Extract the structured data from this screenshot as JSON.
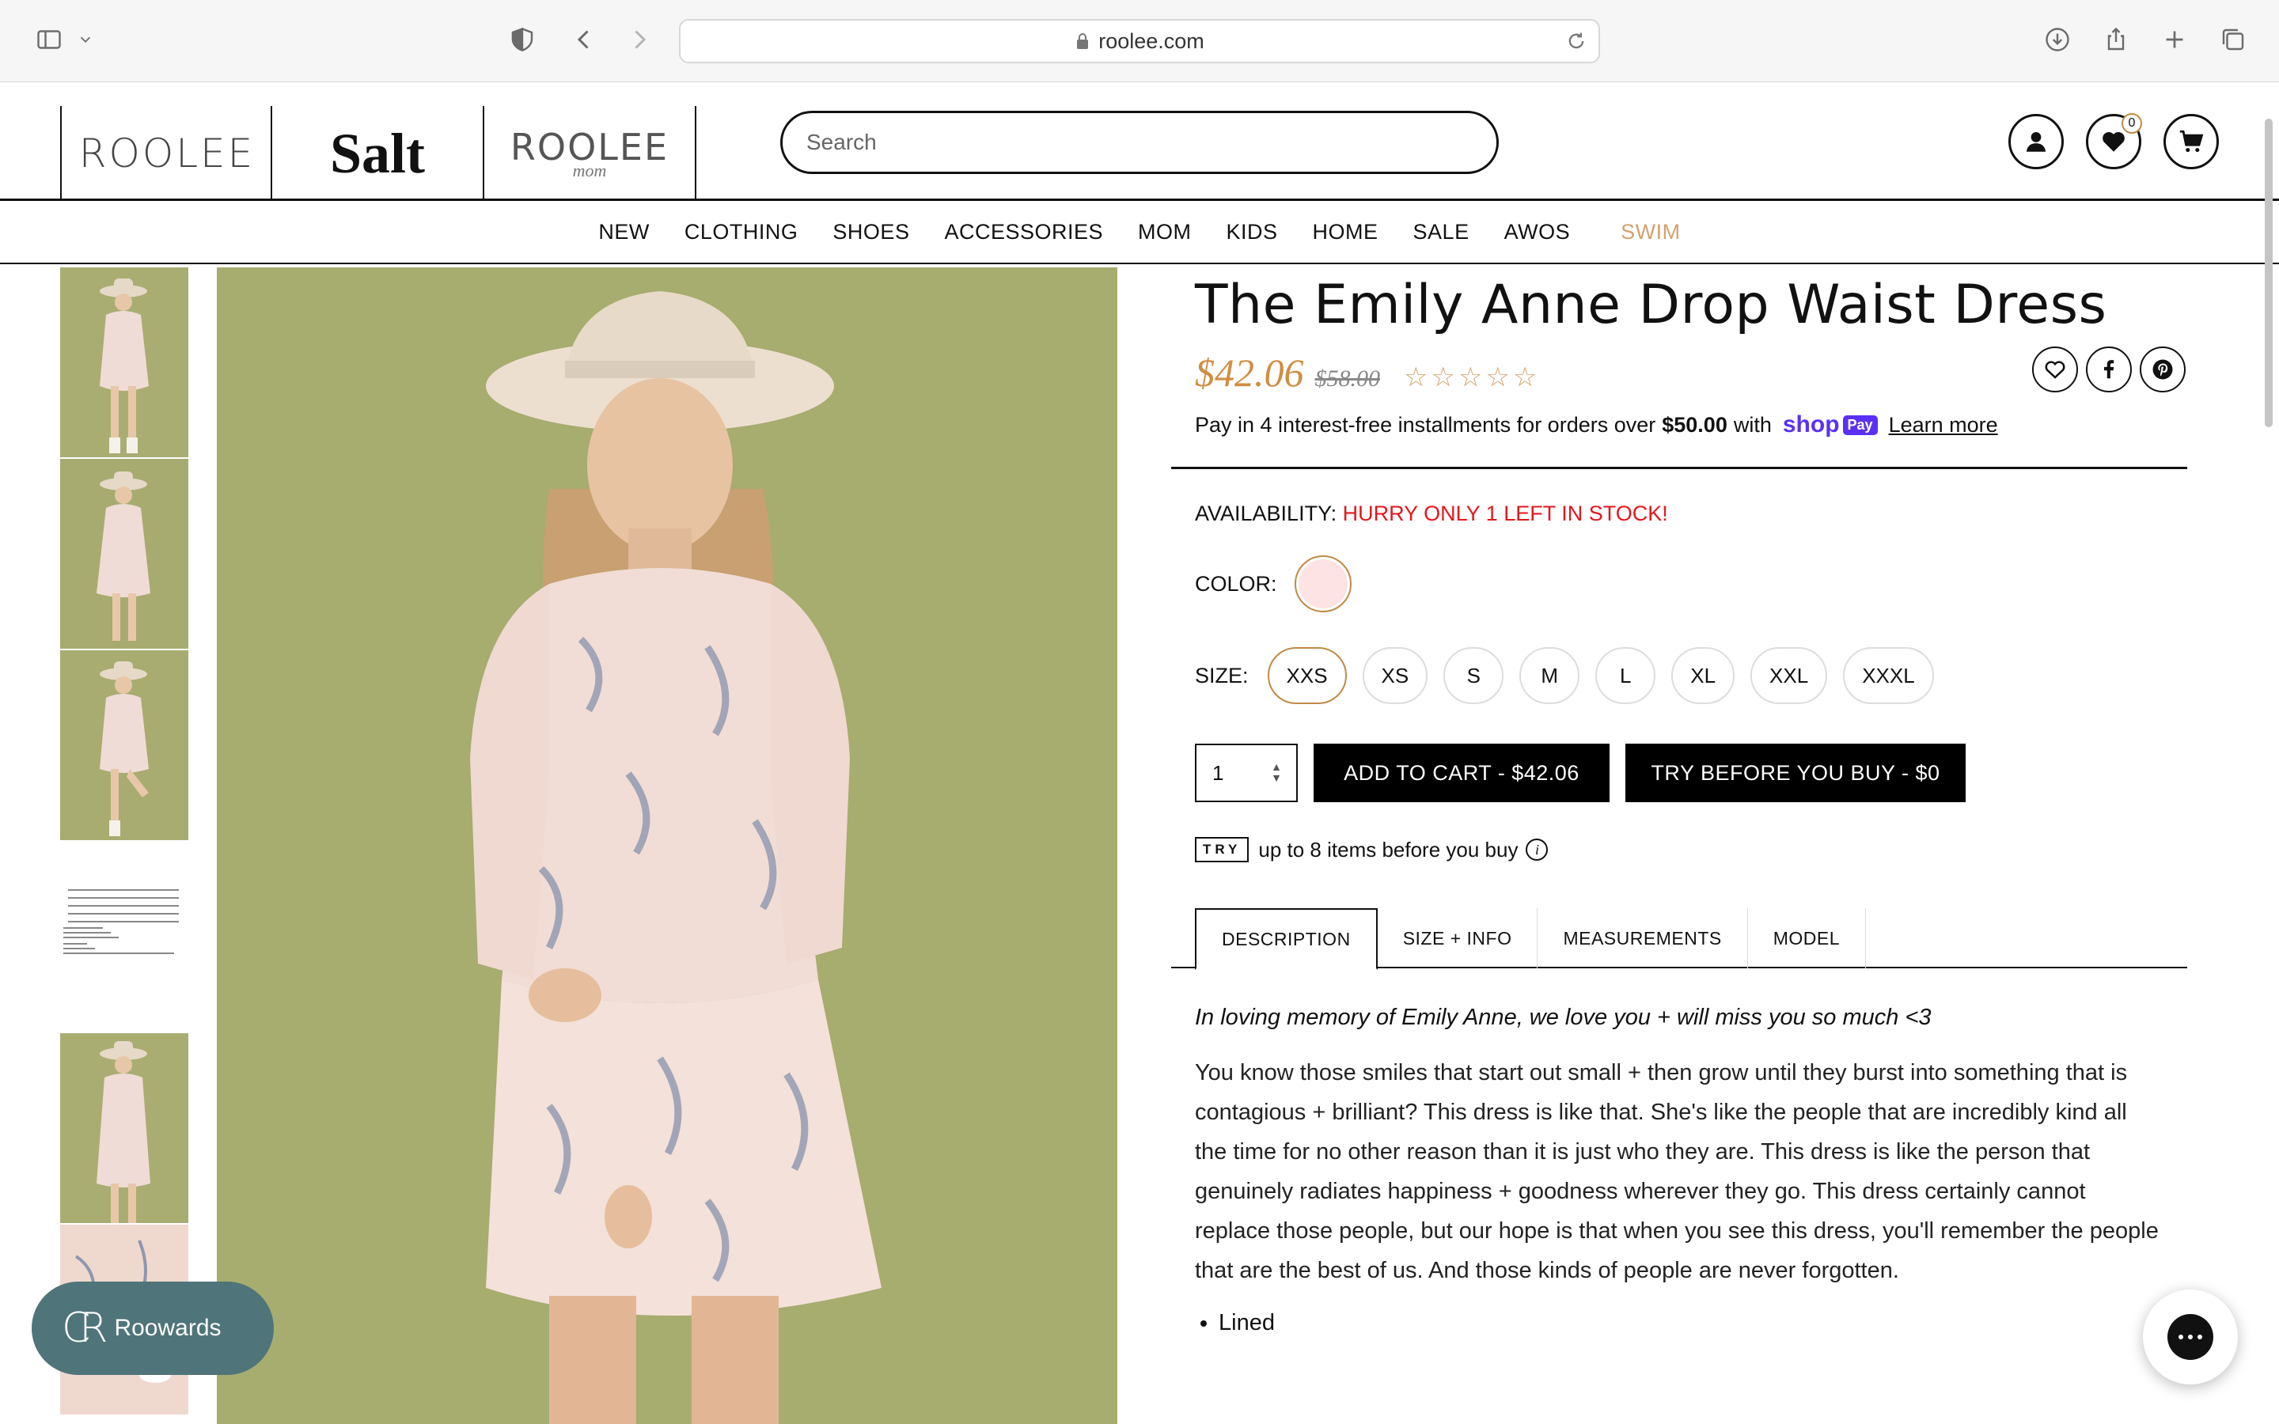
{
  "browser": {
    "url": "roolee.com",
    "icons": [
      "sidebar-icon",
      "chevron-down-icon",
      "shield-icon",
      "back-icon",
      "forward-icon",
      "lock-icon",
      "reload-icon",
      "download-icon",
      "share-icon",
      "new-tab-icon",
      "tabs-icon"
    ]
  },
  "header": {
    "brands": [
      "ROOLEE",
      "Salt",
      "ROOLEE",
      "mom"
    ],
    "search_placeholder": "Search",
    "wishlist_count": "0"
  },
  "nav": {
    "items": [
      "NEW",
      "CLOTHING",
      "SHOES",
      "ACCESSORIES",
      "MOM",
      "KIDS",
      "HOME",
      "SALE",
      "AWOS",
      "SWIM"
    ]
  },
  "product": {
    "title": "The Emily Anne Drop Waist Dress",
    "price": "$42.06",
    "compare_price": "$58.00",
    "rating_stars": "☆☆☆☆☆",
    "rating": 0,
    "installments": {
      "prefix": "Pay in 4 interest-free installments for orders over",
      "threshold": "$50.00",
      "with": "with",
      "shop": "shop",
      "pay": "Pay",
      "learn_more": "Learn more"
    },
    "availability_label": "AVAILABILITY:",
    "availability_value": "HURRY ONLY 1 LEFT IN STOCK!",
    "color_label": "COLOR:",
    "color_swatch": "#fde3e3",
    "size_label": "SIZE:",
    "sizes": [
      "XXS",
      "XS",
      "S",
      "M",
      "L",
      "XL",
      "XXL",
      "XXXL"
    ],
    "selected_size": "XXS",
    "quantity": "1",
    "add_to_cart": "ADD TO CART - $42.06",
    "try_before": "TRY BEFORE YOU BUY - $0",
    "try_badge": "TRY",
    "try_text": "up to 8 items before you buy",
    "info_glyph": "i",
    "tabs": [
      "DESCRIPTION",
      "SIZE + INFO",
      "MEASUREMENTS",
      "MODEL"
    ],
    "memo": "In loving memory of Emily Anne, we love you + will miss you so much <3",
    "description": "You know those smiles that start out small + then grow until they burst into something that is contagious + brilliant? This dress is like that. She's like the people that are incredibly kind all the time for no other reason than it is just who they are. This dress is like the person that genuinely radiates happiness + goodness wherever they go. This dress certainly cannot replace those people, but our hope is that when you see this dress, you'll remember the people that are the best of us. And those kinds of people are never forgotten.",
    "bullets": [
      "Lined"
    ]
  },
  "rewards": {
    "logo": "CR",
    "label": "Roowards"
  },
  "colors": {
    "accent": "#d08d42",
    "stock_red": "#e3171c",
    "swim": "#d4a26c",
    "photo_bg": "#a7ac6f",
    "rewards_bg": "#4f7479",
    "shoppay": "#5a31f4"
  }
}
